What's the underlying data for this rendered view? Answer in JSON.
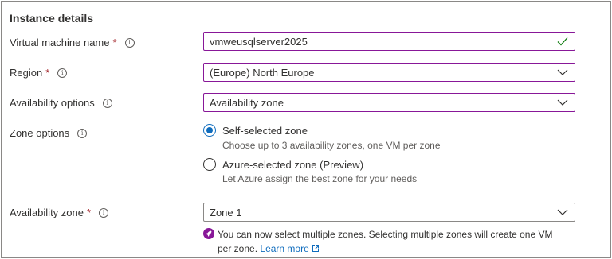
{
  "section": {
    "title": "Instance details"
  },
  "fields": {
    "vm_name": {
      "label": "Virtual machine name",
      "required": "*",
      "value": "vmweusqlserver2025"
    },
    "region": {
      "label": "Region",
      "required": "*",
      "value": "(Europe) North Europe"
    },
    "availability_options": {
      "label": "Availability options",
      "value": "Availability zone"
    },
    "zone_options": {
      "label": "Zone options",
      "options": [
        {
          "title": "Self-selected zone",
          "description": "Choose up to 3 availability zones, one VM per zone",
          "selected": true
        },
        {
          "title": "Azure-selected zone (Preview)",
          "description": "Let Azure assign the best zone for your needs",
          "selected": false
        }
      ]
    },
    "availability_zone": {
      "label": "Availability zone",
      "required": "*",
      "value": "Zone 1"
    }
  },
  "note": {
    "text": "You can now select multiple zones. Selecting multiple zones will create one VM per zone.",
    "link_label": "Learn more"
  },
  "icons": {
    "info": "info-icon",
    "check": "checkmark-icon",
    "dropdown": "chevron-down-icon",
    "rocket": "rocket-icon",
    "external": "external-link-icon"
  },
  "colors": {
    "accent_blue": "#0f6cbd",
    "focus_purple": "#881798",
    "required_red": "#a4262c",
    "valid_green": "#107c10"
  }
}
